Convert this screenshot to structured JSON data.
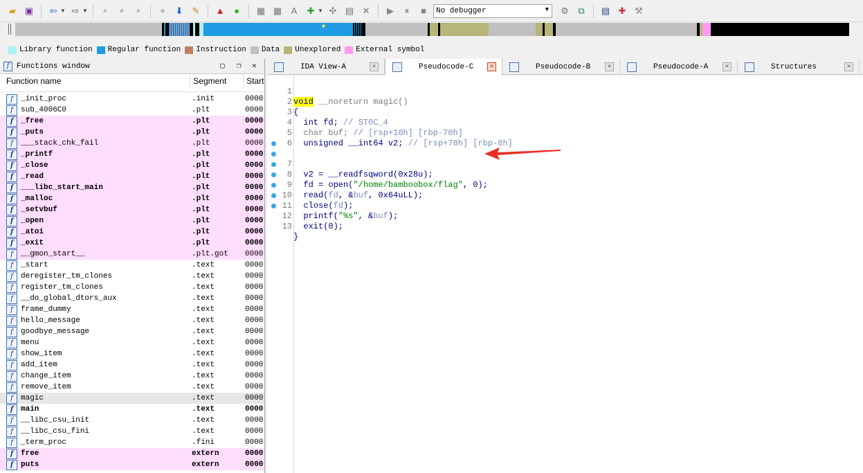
{
  "toolbar": {
    "debugger": "No debugger",
    "icons": [
      "open-folder-icon",
      "save-icon",
      "back-icon",
      "forward-icon",
      "search-bin-icon",
      "search-text-icon",
      "search-imm-icon",
      "search-next-icon",
      "jump-icon",
      "patch-icon",
      "warning-icon",
      "run-icon",
      "make-code-icon",
      "make-data-icon",
      "make-string-icon",
      "make-struct-icon",
      "hide-icon",
      "undefine-icon",
      "play-icon",
      "pause-icon",
      "stop-icon",
      "attach-icon",
      "debugger-run-icon",
      "graph-icon",
      "color-icon",
      "settings-icon"
    ]
  },
  "legend": [
    {
      "label": "Library function",
      "color": "#aaf1f1"
    },
    {
      "label": "Regular function",
      "color": "#1e9be2"
    },
    {
      "label": "Instruction",
      "color": "#c08060"
    },
    {
      "label": "Data",
      "color": "#c0c0c0"
    },
    {
      "label": "Unexplored",
      "color": "#b8b57a"
    },
    {
      "label": "External symbol",
      "color": "#ff9bf0"
    }
  ],
  "functions_window": {
    "title": "Functions window",
    "headers": {
      "name": "Function name",
      "segment": "Segment",
      "start": "Start"
    },
    "rows": [
      {
        "name": "_init_proc",
        "segment": ".init",
        "start": "0000",
        "type": "normal"
      },
      {
        "name": "sub_4006C0",
        "segment": ".plt",
        "start": "0000",
        "type": "normal"
      },
      {
        "name": "_free",
        "segment": ".plt",
        "start": "0000",
        "type": "ext"
      },
      {
        "name": "_puts",
        "segment": ".plt",
        "start": "0000",
        "type": "ext"
      },
      {
        "name": "___stack_chk_fail",
        "segment": ".plt",
        "start": "0000",
        "type": "ext-light"
      },
      {
        "name": "_printf",
        "segment": ".plt",
        "start": "0000",
        "type": "ext"
      },
      {
        "name": "_close",
        "segment": ".plt",
        "start": "0000",
        "type": "ext"
      },
      {
        "name": "_read",
        "segment": ".plt",
        "start": "0000",
        "type": "ext"
      },
      {
        "name": "___libc_start_main",
        "segment": ".plt",
        "start": "0000",
        "type": "ext"
      },
      {
        "name": "_malloc",
        "segment": ".plt",
        "start": "0000",
        "type": "ext"
      },
      {
        "name": "_setvbuf",
        "segment": ".plt",
        "start": "0000",
        "type": "ext"
      },
      {
        "name": "_open",
        "segment": ".plt",
        "start": "0000",
        "type": "ext"
      },
      {
        "name": "_atoi",
        "segment": ".plt",
        "start": "0000",
        "type": "ext"
      },
      {
        "name": "_exit",
        "segment": ".plt",
        "start": "0000",
        "type": "ext"
      },
      {
        "name": "__gmon_start__",
        "segment": ".plt.got",
        "start": "0000",
        "type": "ext-light"
      },
      {
        "name": "_start",
        "segment": ".text",
        "start": "0000",
        "type": "normal"
      },
      {
        "name": "deregister_tm_clones",
        "segment": ".text",
        "start": "0000",
        "type": "normal"
      },
      {
        "name": "register_tm_clones",
        "segment": ".text",
        "start": "0000",
        "type": "normal"
      },
      {
        "name": "__do_global_dtors_aux",
        "segment": ".text",
        "start": "0000",
        "type": "normal"
      },
      {
        "name": "frame_dummy",
        "segment": ".text",
        "start": "0000",
        "type": "normal"
      },
      {
        "name": "hello_message",
        "segment": ".text",
        "start": "0000",
        "type": "normal"
      },
      {
        "name": "goodbye_message",
        "segment": ".text",
        "start": "0000",
        "type": "normal"
      },
      {
        "name": "menu",
        "segment": ".text",
        "start": "0000",
        "type": "normal"
      },
      {
        "name": "show_item",
        "segment": ".text",
        "start": "0000",
        "type": "normal"
      },
      {
        "name": "add_item",
        "segment": ".text",
        "start": "0000",
        "type": "normal"
      },
      {
        "name": "change_item",
        "segment": ".text",
        "start": "0000",
        "type": "normal"
      },
      {
        "name": "remove_item",
        "segment": ".text",
        "start": "0000",
        "type": "normal"
      },
      {
        "name": "magic",
        "segment": ".text",
        "start": "0000",
        "type": "selected"
      },
      {
        "name": "main",
        "segment": ".text",
        "start": "0000",
        "type": "bold"
      },
      {
        "name": "__libc_csu_init",
        "segment": ".text",
        "start": "0000",
        "type": "normal"
      },
      {
        "name": "__libc_csu_fini",
        "segment": ".text",
        "start": "0000",
        "type": "normal"
      },
      {
        "name": "_term_proc",
        "segment": ".fini",
        "start": "0000",
        "type": "normal"
      },
      {
        "name": "free",
        "segment": "extern",
        "start": "0000",
        "type": "ext"
      },
      {
        "name": "puts",
        "segment": "extern",
        "start": "0000",
        "type": "ext"
      }
    ]
  },
  "tabs": [
    {
      "label": "IDA View-A",
      "active": false
    },
    {
      "label": "Pseudocode-C",
      "active": true
    },
    {
      "label": "Pseudocode-B",
      "active": false
    },
    {
      "label": "Pseudocode-A",
      "active": false
    },
    {
      "label": "Structures",
      "active": false
    }
  ],
  "code": {
    "line_numbers": [
      "1",
      "2",
      "3",
      "4",
      "5",
      "6",
      "7",
      "8",
      "9",
      "10",
      "11",
      "12",
      "13"
    ],
    "l1_kw": "void",
    "l1_rest": " __noreturn magic()",
    "l2": "{",
    "l3_a": "  int fd; ",
    "l3_c": "// ST0C_4",
    "l4_a": "  char buf; ",
    "l4_c": "// [rsp+10h] [rbp-70h]",
    "l5_a": "  unsigned __int64 v2; ",
    "l5_c": "// [rsp+78h] [rbp-8h]",
    "l7": "  v2 = __readfsqword(0x28u);",
    "l8_a": "  fd = open(",
    "l8_s": "\"/home/bamboobox/flag\"",
    "l8_b": ", 0);",
    "l9_a": "  read(",
    "l9_v": "fd",
    "l9_b": ", &",
    "l9_v2": "buf",
    "l9_c": ", 0x64uLL);",
    "l10_a": "  close(",
    "l10_v": "fd",
    "l10_b": ");",
    "l11_a": "  printf(",
    "l11_s": "\"%s\"",
    "l11_b": ", &",
    "l11_v": "buf",
    "l11_c": ");",
    "l12": "  exit(0);",
    "l13": "}"
  }
}
